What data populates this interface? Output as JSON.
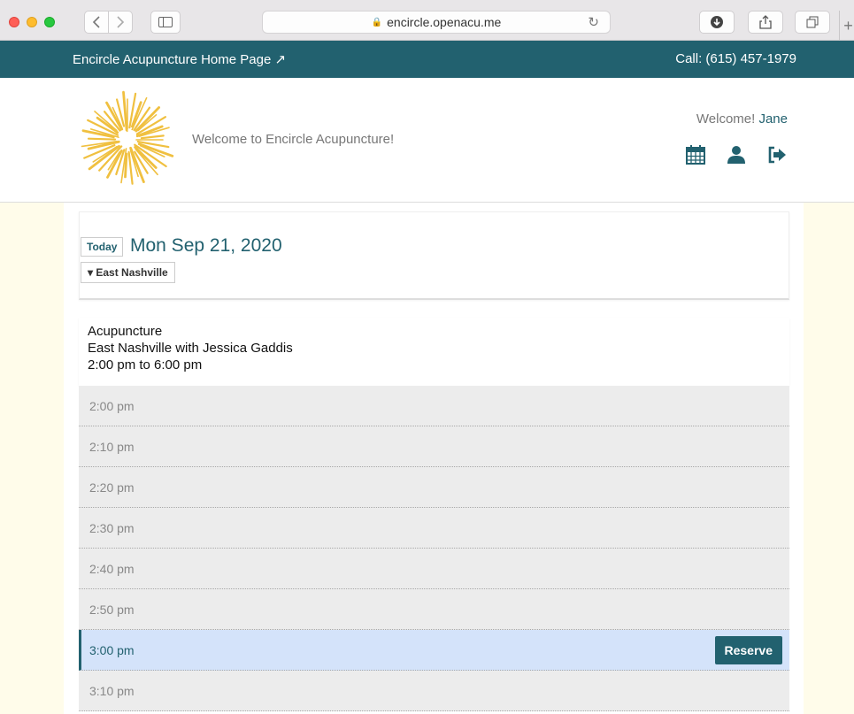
{
  "browser": {
    "url": "encircle.openacu.me"
  },
  "topbar": {
    "home_link": "Encircle Acupuncture Home Page ↗",
    "call": "Call: (615) 457-1979"
  },
  "header": {
    "tagline": "Welcome to Encircle Acupuncture!",
    "welcome_prefix": "Welcome! ",
    "user_name": "Jane",
    "icons": [
      "calendar-icon",
      "user-icon",
      "sign-out-icon"
    ],
    "accent_color": "#22616f",
    "logo_color": "#f0c040"
  },
  "date_nav": {
    "today_label": "Today",
    "date": "Mon Sep 21, 2020",
    "location": "▾ East Nashville"
  },
  "appointment": {
    "type": "Acupuncture",
    "location_practitioner": "East Nashville with Jessica Gaddis",
    "hours": "2:00 pm to 6:00 pm"
  },
  "slots": [
    {
      "time": "2:00 pm"
    },
    {
      "time": "2:10 pm"
    },
    {
      "time": "2:20 pm"
    },
    {
      "time": "2:30 pm"
    },
    {
      "time": "2:40 pm"
    },
    {
      "time": "2:50 pm"
    },
    {
      "time": "3:00 pm",
      "selected": true,
      "action": "Reserve"
    },
    {
      "time": "3:10 pm"
    }
  ]
}
